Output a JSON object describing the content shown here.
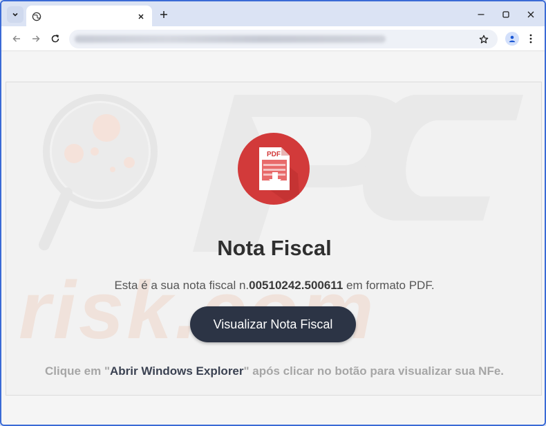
{
  "browser": {
    "tab_title": "",
    "new_tab_label": "+",
    "url": "",
    "colors": {
      "frame": "#3a6ad6",
      "tabstrip": "#dbe3f4"
    }
  },
  "icons": {
    "tab_search": "chevron-down-icon",
    "favicon": "globe-icon",
    "close": "close-icon",
    "back": "arrow-left-icon",
    "forward": "arrow-right-icon",
    "reload": "reload-icon",
    "bookmark": "star-icon",
    "profile": "person-icon",
    "menu": "kebab-menu-icon"
  },
  "page": {
    "pdf_badge": "PDF",
    "title": "Nota Fiscal",
    "desc_prefix": "Esta é a sua nota fiscal n.",
    "desc_number": "00510242.500611",
    "desc_suffix": " em formato PDF.",
    "button_label": "Visualizar Nota Fiscal",
    "hint_prefix": "Clique em \"",
    "hint_strong": "Abrir Windows Explorer",
    "hint_suffix": "\" após clicar no botão para visualizar sua NFe.",
    "watermark_text": "risk.com",
    "colors": {
      "pdf_red": "#d23a3a",
      "button": "#2c3445"
    }
  }
}
